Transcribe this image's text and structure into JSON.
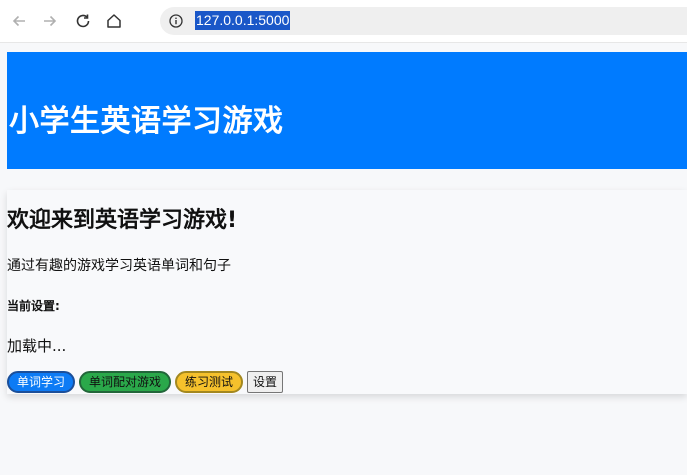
{
  "browser": {
    "url": "127.0.0.1:5000",
    "icons": {
      "back": "arrow-left-icon",
      "forward": "arrow-right-icon",
      "reload": "reload-icon",
      "home": "home-icon",
      "site_info": "info-icon"
    }
  },
  "header": {
    "title": "小学生英语学习游戏",
    "background": "#007bff"
  },
  "main": {
    "welcome": "欢迎来到英语学习游戏!",
    "subtitle": "通过有趣的游戏学习英语单词和句子",
    "settings_label": "当前设置:",
    "loading": "加载中..."
  },
  "buttons": {
    "word_study": "单词学习",
    "match_game": "单词配对游戏",
    "practice_test": "练习测试",
    "settings": "设置"
  },
  "colors": {
    "accent_blue": "#0d7bf5",
    "accent_green": "#2aa84a",
    "accent_yellow": "#f5c12c"
  }
}
